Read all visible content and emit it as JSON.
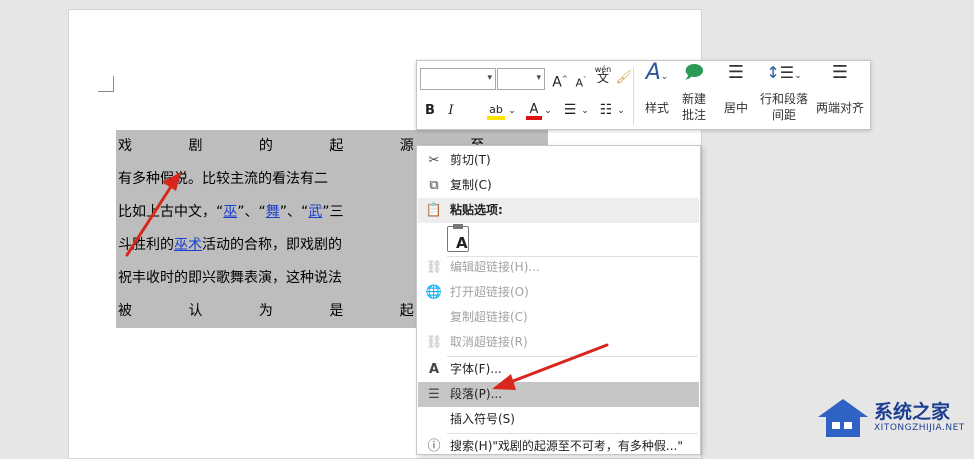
{
  "document": {
    "lines": [
      "戏 剧 的 起 源 至",
      "有多种假说。比较主流的看法有二",
      "比如上古中文，“",
      "斗胜利的",
      "祝丰收时的即兴歌舞表演，这种说法",
      "被 认 为 是 起 源"
    ],
    "line3_parts": {
      "a": "比如上古中文，“",
      "wu1": "巫",
      "b": "”、“",
      "wu2": "舞",
      "c": "”、“",
      "wu3": "武",
      "d": "”三"
    },
    "line4_parts": {
      "a": "斗胜利的",
      "link": "巫术",
      "b": "活动的合称，即戏剧的"
    }
  },
  "mini_toolbar": {
    "font_name_value": "",
    "font_size_value": "",
    "grow_font": "A",
    "shrink_font": "A",
    "phonetic": "wén",
    "phonetic_char": "文",
    "bold": "B",
    "italic": "I",
    "highlight": "ab",
    "font_color": "A",
    "styles_label": "样式",
    "new_comment_label_1": "新建",
    "new_comment_label_2": "批注",
    "center_label": "居中",
    "line_spacing_label_1": "行和段落",
    "line_spacing_label_2": "间距",
    "justify_label": "两端对齐"
  },
  "context_menu": {
    "items": [
      {
        "label": "剪切(T)",
        "icon": "scissors-icon",
        "enabled": true
      },
      {
        "label": "复制(C)",
        "icon": "copy-icon",
        "enabled": true
      },
      {
        "label": "粘贴选项:",
        "icon": "paste-icon",
        "enabled": true
      },
      {
        "label": "编辑超链接(H)...",
        "icon": "link-edit-icon",
        "enabled": false
      },
      {
        "label": "打开超链接(O)",
        "icon": "link-open-icon",
        "enabled": false
      },
      {
        "label": "复制超链接(C)",
        "icon": "link-copy-icon",
        "enabled": false
      },
      {
        "label": "取消超链接(R)",
        "icon": "unlink-icon",
        "enabled": false
      },
      {
        "label": "字体(F)...",
        "icon": "font-icon",
        "enabled": true
      },
      {
        "label": "段落(P)...",
        "icon": "paragraph-icon",
        "enabled": true,
        "highlighted": true
      },
      {
        "label": "插入符号(S)",
        "icon": "",
        "enabled": true
      },
      {
        "label": "搜索(H)\"戏剧的起源至不可考，有多种假...\"",
        "icon": "info-icon",
        "enabled": true
      }
    ],
    "paste_option_glyph": "A"
  },
  "watermark": {
    "name": "系统之家",
    "url": "XITONGZHIJIA.NET"
  },
  "colors": {
    "selection": "#bdbdbd",
    "hyperlink": "#1a3fcf",
    "arrow": "#d9261c",
    "highlight_yellow": "#ffe600",
    "font_red": "#e01010",
    "watermark_blue": "#1d3f8f"
  }
}
